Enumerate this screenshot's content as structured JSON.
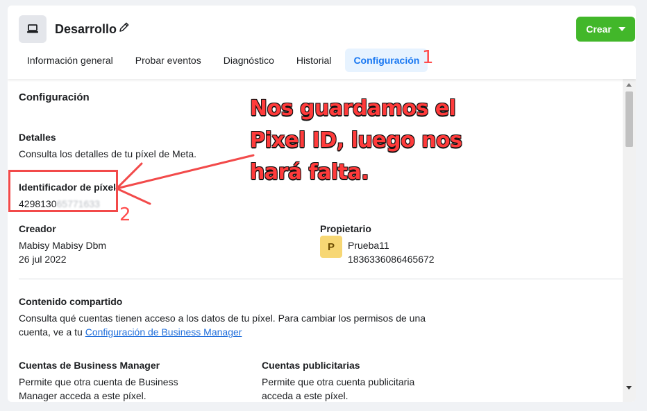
{
  "header": {
    "app_title": "Desarrollo",
    "create_label": "Crear",
    "tabs": [
      {
        "label": "Información general",
        "active": false
      },
      {
        "label": "Probar eventos",
        "active": false
      },
      {
        "label": "Diagnóstico",
        "active": false
      },
      {
        "label": "Historial",
        "active": false
      },
      {
        "label": "Configuración",
        "active": true
      }
    ]
  },
  "settings": {
    "title": "Configuración",
    "details": {
      "label": "Detalles",
      "description": "Consulta los detalles de tu píxel de Meta."
    },
    "pixel_id": {
      "label": "Identificador de píxel",
      "value_visible": "4298130",
      "value_blurred": "65771633"
    },
    "creator": {
      "label": "Creador",
      "name": "Mabisy Mabisy Dbm",
      "date": "26 jul 2022"
    },
    "owner": {
      "label": "Propietario",
      "avatar_letter": "P",
      "name": "Prueba11",
      "id": "1836336086465672"
    },
    "shared": {
      "label": "Contenido compartido",
      "description": "Consulta qué cuentas tienen acceso a los datos de tu píxel. Para cambiar los permisos de una cuenta, ve a tu",
      "link": "Configuración de Business Manager"
    },
    "bm_accounts": {
      "label": "Cuentas de Business Manager",
      "description": "Permite que otra cuenta de Business Manager acceda a este píxel."
    },
    "ad_accounts": {
      "label": "Cuentas publicitarias",
      "description": "Permite que otra cuenta publicitaria acceda a este píxel."
    }
  },
  "annotations": {
    "note": "Nos guardamos el Pixel ID, luego nos hará falta.",
    "step1": "1",
    "step2": "2"
  },
  "colors": {
    "accent": "#1877f2",
    "create_button": "#42b72a",
    "annotation": "#f24a4a",
    "avatar": "#f7d774"
  },
  "icons": {
    "app": "laptop-icon",
    "edit": "pencil-icon",
    "create_caret": "caret-down-icon"
  }
}
